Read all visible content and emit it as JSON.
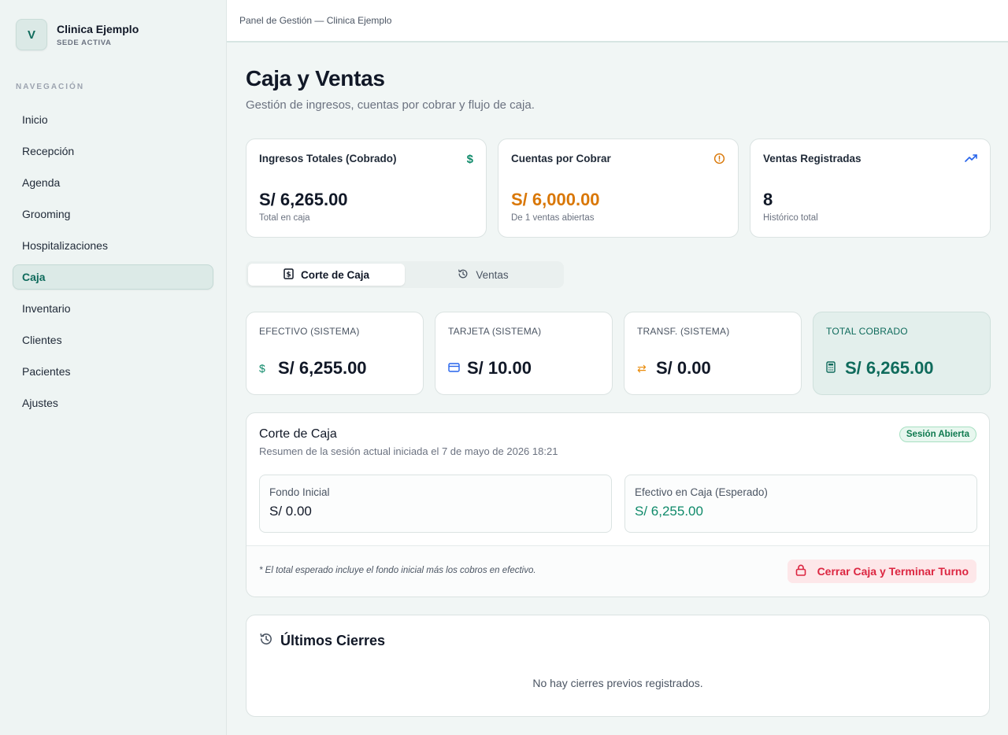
{
  "brand": {
    "initial": "V",
    "name": "Clinica Ejemplo",
    "subtitle": "SEDE ACTIVA"
  },
  "nav": {
    "label": "NAVEGACIÓN",
    "items": [
      {
        "label": "Inicio"
      },
      {
        "label": "Recepción"
      },
      {
        "label": "Agenda"
      },
      {
        "label": "Grooming"
      },
      {
        "label": "Hospitalizaciones"
      },
      {
        "label": "Caja",
        "active": true
      },
      {
        "label": "Inventario"
      },
      {
        "label": "Clientes"
      },
      {
        "label": "Pacientes"
      },
      {
        "label": "Ajustes"
      }
    ]
  },
  "header": {
    "breadcrumb": "Panel de Gestión — Clinica Ejemplo"
  },
  "page": {
    "title": "Caja y Ventas",
    "subtitle": "Gestión de ingresos, cuentas por cobrar y flujo de caja."
  },
  "stats": [
    {
      "title": "Ingresos Totales (Cobrado)",
      "value": "S/ 6,265.00",
      "note": "Total en caja",
      "icon": "dollar-icon",
      "value_color": "#111827"
    },
    {
      "title": "Cuentas por Cobrar",
      "value": "S/ 6,000.00",
      "note": "De 1 ventas abiertas",
      "icon": "alert-circle-icon",
      "value_color": "#d97706"
    },
    {
      "title": "Ventas Registradas",
      "value": "8",
      "note": "Histórico total",
      "icon": "trending-up-icon",
      "value_color": "#111827"
    }
  ],
  "tabs": [
    {
      "label": "Corte de Caja",
      "active": true,
      "icon": "receipt-icon"
    },
    {
      "label": "Ventas",
      "active": false,
      "icon": "history-icon"
    }
  ],
  "payments": [
    {
      "title": "EFECTIVO (SISTEMA)",
      "value": "S/ 6,255.00",
      "icon": "dollar-icon"
    },
    {
      "title": "TARJETA (SISTEMA)",
      "value": "S/ 10.00",
      "icon": "credit-card-icon"
    },
    {
      "title": "TRANSF. (SISTEMA)",
      "value": "S/ 0.00",
      "icon": "transfer-icon"
    },
    {
      "title": "TOTAL COBRADO",
      "value": "S/ 6,265.00",
      "icon": "calculator-icon"
    }
  ],
  "corte": {
    "title": "Corte de Caja",
    "subtitle": "Resumen de la sesión actual iniciada el 7 de mayo de 2026 18:21",
    "badge": "Sesión Abierta",
    "fondo_label": "Fondo Inicial",
    "fondo_value": "S/ 0.00",
    "esperado_label": "Efectivo en Caja (Esperado)",
    "esperado_value": "S/ 6,255.00",
    "footnote": "* El total esperado incluye el fondo inicial más los cobros en efectivo.",
    "close_button": "Cerrar Caja y Terminar Turno"
  },
  "ultimos": {
    "title": "Últimos Cierres",
    "empty": "No hay cierres previos registrados."
  },
  "colors": {
    "accent": "#0f6b5c",
    "success": "#0f8a6a",
    "warning": "#d97706",
    "danger": "#dc2641",
    "info": "#2563eb"
  }
}
